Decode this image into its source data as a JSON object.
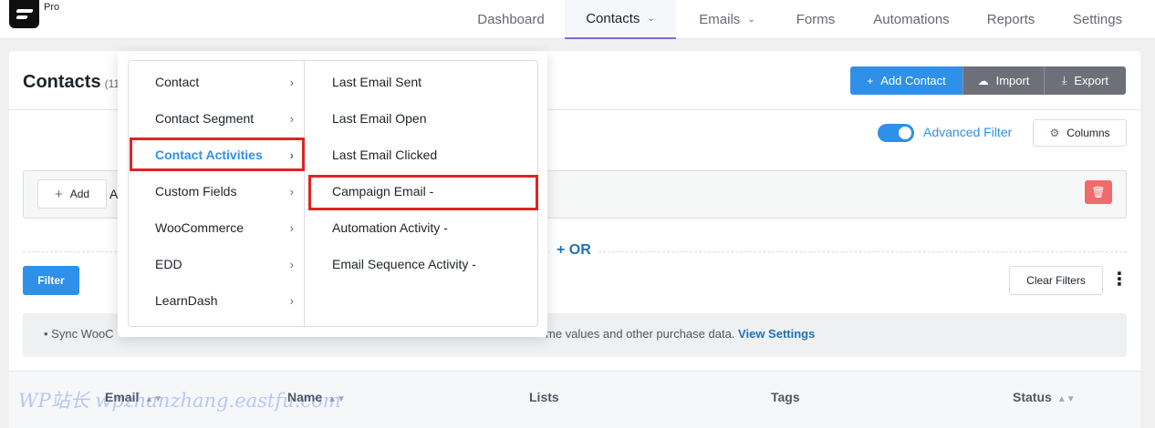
{
  "header": {
    "pro_label": "Pro",
    "nav": [
      {
        "label": "Dashboard"
      },
      {
        "label": "Contacts",
        "active": true
      },
      {
        "label": "Emails"
      },
      {
        "label": "Forms"
      },
      {
        "label": "Automations"
      },
      {
        "label": "Reports"
      },
      {
        "label": "Settings"
      }
    ]
  },
  "page": {
    "title": "Contacts",
    "count_partial": "(11",
    "add_contact": "Add Contact",
    "import": "Import",
    "export": "Export",
    "advanced_filter": "Advanced Filter",
    "columns": "Columns",
    "advanced_filter_on": true
  },
  "filter": {
    "add_label": "Add",
    "add_trail": "A",
    "or_label": "OR",
    "filter_button": "Filter",
    "clear_filters": "Clear Filters"
  },
  "notice": {
    "bullet_text": "• Sync WooC",
    "middle_text": "me values and other purchase data.",
    "link_text": "View Settings"
  },
  "table": {
    "headers": [
      "Email",
      "Name",
      "Lists",
      "Tags",
      "Status"
    ]
  },
  "watermark": "WP站长 wpzhanzhang.eastfu.com",
  "dropdown": {
    "categories": [
      {
        "label": "Contact"
      },
      {
        "label": "Contact Segment"
      },
      {
        "label": "Contact Activities",
        "active": true
      },
      {
        "label": "Custom Fields"
      },
      {
        "label": "WooCommerce"
      },
      {
        "label": "EDD"
      },
      {
        "label": "LearnDash"
      }
    ],
    "subitems": [
      {
        "label": "Last Email Sent"
      },
      {
        "label": "Last Email Open"
      },
      {
        "label": "Last Email Clicked"
      },
      {
        "label": "Campaign Email -",
        "highlighted": true
      },
      {
        "label": "Automation Activity -"
      },
      {
        "label": "Email Sequence Activity -"
      }
    ]
  },
  "colors": {
    "primary": "#2e90e8",
    "secondary_button": "#6e7079",
    "danger": "#f06c6c",
    "highlight": "#e02424",
    "nav_underline": "#7a6dd1"
  },
  "icons": {
    "add_contact": "plus-icon",
    "import": "cloud-upload-icon",
    "export": "download-icon",
    "columns": "gear-icon",
    "trash": "trash-icon",
    "submenu": "chevron-right-icon",
    "nav_dropdown": "chevron-down-icon",
    "more": "kebab-icon",
    "sort": "sort-icon"
  }
}
